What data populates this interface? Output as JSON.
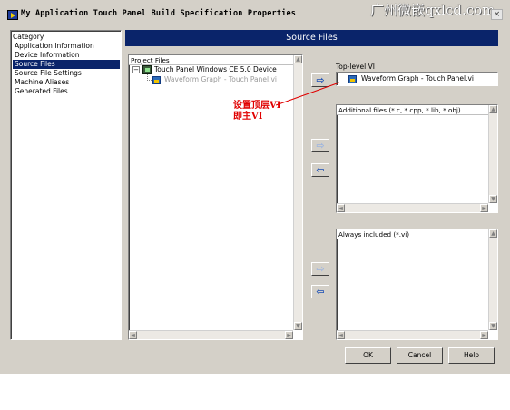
{
  "window": {
    "title": "My Application Touch Panel Build Specification Properties",
    "watermark": "广州微嵌qxlcd.com",
    "close_glyph": "×"
  },
  "category": {
    "header": "Category",
    "items": [
      {
        "label": "Application Information",
        "selected": false
      },
      {
        "label": "Device Information",
        "selected": false
      },
      {
        "label": "Source Files",
        "selected": true
      },
      {
        "label": "Source File Settings",
        "selected": false
      },
      {
        "label": "Machine Aliases",
        "selected": false
      },
      {
        "label": "Generated Files",
        "selected": false
      }
    ]
  },
  "page_header": "Source Files",
  "project_files": {
    "header": "Project Files",
    "tree": [
      {
        "label": "Touch Panel Windows CE 5.0 Device",
        "expander": "⊟",
        "icon": "touch-panel-target-icon"
      },
      {
        "label": "Waveform Graph - Touch Panel.vi",
        "icon": "vi-icon",
        "dimmed": true
      }
    ]
  },
  "top_level_vi": {
    "label": "Top-level VI",
    "value": "Waveform Graph - Touch Panel.vi",
    "icon": "vi-icon"
  },
  "annotation": {
    "line1": "设置顶层VI",
    "line2": "即主VI",
    "color": "#e00000"
  },
  "additional_files": {
    "header": "Additional files (*.c, *.cpp, *.lib, *.obj)"
  },
  "always_included": {
    "header": "Always included (*.vi)"
  },
  "arrows": {
    "add": "⇨",
    "remove": "⇦"
  },
  "scroll_glyphs": {
    "up": "▲",
    "down": "▼",
    "left": "◄",
    "right": "►"
  },
  "buttons": {
    "ok": "OK",
    "cancel": "Cancel",
    "help": "Help"
  }
}
